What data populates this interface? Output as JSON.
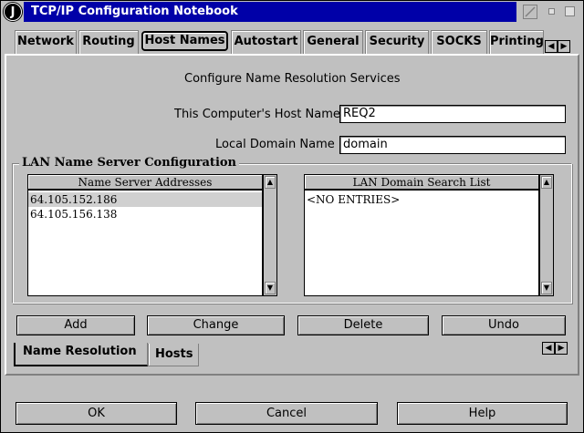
{
  "window": {
    "title": "TCP/IP Configuration Notebook",
    "sys_glyph": "J"
  },
  "tabs": [
    "Network",
    "Routing",
    "Host Names",
    "Autostart",
    "General",
    "Security",
    "SOCKS",
    "Printing"
  ],
  "active_tab": "Host Names",
  "page": {
    "heading": "Configure Name Resolution Services",
    "host_name_label": "This Computer's Host Name",
    "host_name_value": "REQ2",
    "domain_label": "Local Domain Name",
    "domain_value": "domain"
  },
  "group": {
    "title": "LAN Name Server Configuration",
    "servers_header": "Name Server Addresses",
    "servers": [
      "64.105.152.186",
      "64.105.156.138"
    ],
    "search_header": "LAN Domain Search List",
    "search_items": [
      "<NO ENTRIES>"
    ]
  },
  "actions": {
    "add": "Add",
    "change": "Change",
    "delete": "Delete",
    "undo": "Undo"
  },
  "sub_tabs": [
    "Name Resolution",
    "Hosts"
  ],
  "footer": {
    "ok": "OK",
    "cancel": "Cancel",
    "help": "Help"
  },
  "icons": {
    "scroll_left": "◀",
    "scroll_right": "▶",
    "scroll_up": "▲",
    "scroll_down": "▼"
  }
}
